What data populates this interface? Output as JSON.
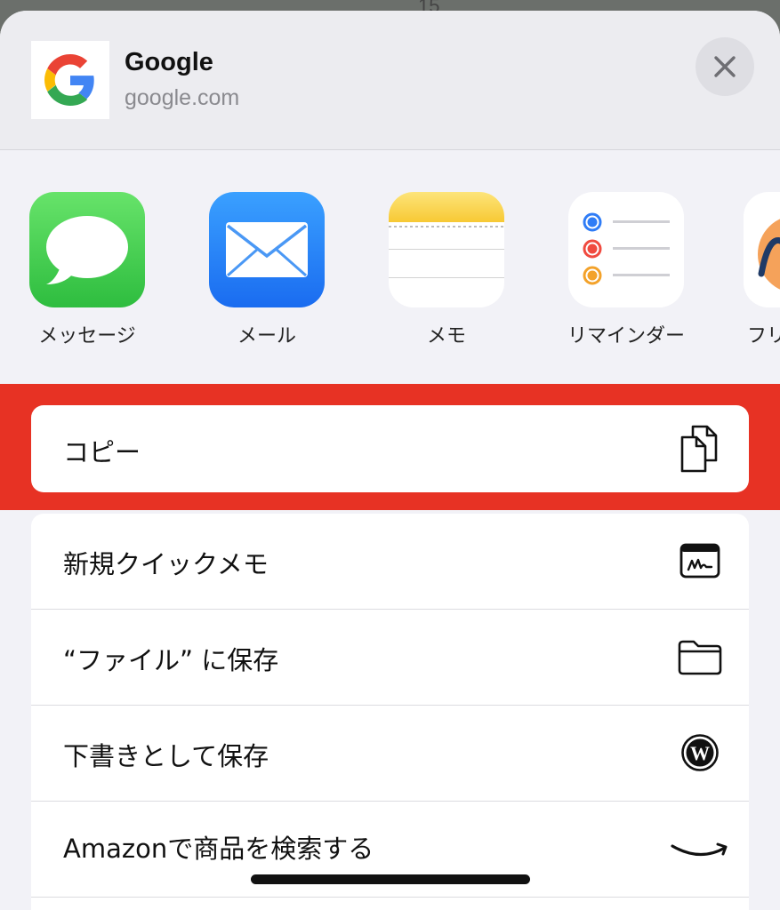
{
  "background": {
    "peek_text": "15"
  },
  "header": {
    "title": "Google",
    "url": "google.com",
    "icon": "google-logo-icon",
    "close_icon": "close-icon"
  },
  "apps": [
    {
      "label": "メッセージ",
      "icon": "messages-icon",
      "color": "#34c759"
    },
    {
      "label": "メール",
      "icon": "mail-icon",
      "color": "#1e7cf5"
    },
    {
      "label": "メモ",
      "icon": "notes-icon",
      "color": "#f9d34a"
    },
    {
      "label": "リマインダー",
      "icon": "reminders-icon",
      "color": "#ffffff"
    },
    {
      "label": "フリ",
      "icon": "freeform-icon",
      "color": "#ffffff"
    }
  ],
  "actions": {
    "copy": {
      "label": "コピー",
      "icon": "copy-icon"
    },
    "items": [
      {
        "label": "新規クイックメモ",
        "icon": "quick-note-icon"
      },
      {
        "label": "“ファイル” に保存",
        "icon": "folder-icon"
      },
      {
        "label": "下書きとして保存",
        "icon": "wordpress-icon"
      },
      {
        "label": "Amazonで商品を検索する",
        "icon": "amazon-icon"
      }
    ]
  },
  "colors": {
    "highlight": "#e73224",
    "sheet": "#f2f2f7"
  }
}
